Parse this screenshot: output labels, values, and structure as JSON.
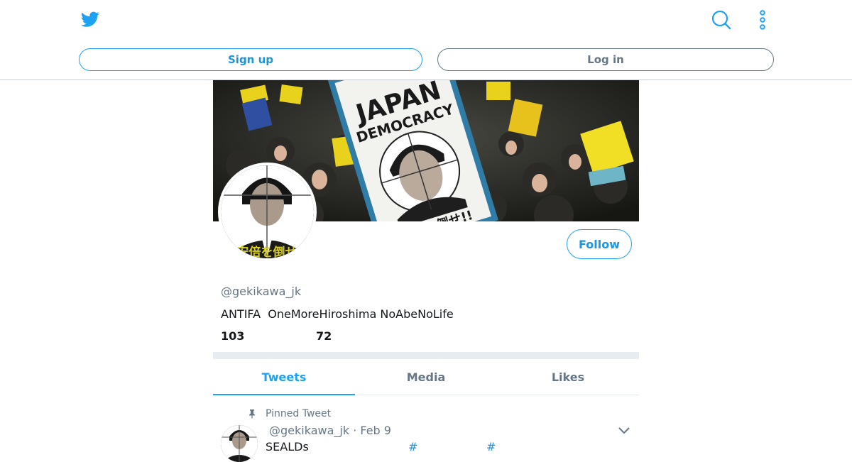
{
  "header": {
    "logo_icon": "twitter-bird-icon",
    "search_icon": "search-icon",
    "more_icon": "more-vertical-icon",
    "signup_label": "Sign up",
    "login_label": "Log in",
    "accent_color": "#1da1f2"
  },
  "banner": {
    "sign_text_1": "JAPAN",
    "sign_text_2": "DEMOCRACY",
    "sign_caption": "安倍を倒せ!!"
  },
  "profile": {
    "handle": "@gekikawa_jk",
    "bio": "ANTIFA  OneMoreHiroshima NoAbeNoLife",
    "following_count": "103",
    "followers_count": "72",
    "follow_label": "Follow",
    "avatar_caption": "安倍を倒せ"
  },
  "tabs": {
    "tweets": "Tweets",
    "media": "Media",
    "likes": "Likes",
    "active": "Tweets"
  },
  "tweet": {
    "pinned_label": "Pinned Tweet",
    "meta": "@gekikawa_jk · Feb 9",
    "text_start": "SEALDs",
    "hashtag_1": "#",
    "hashtag_2": "#"
  }
}
